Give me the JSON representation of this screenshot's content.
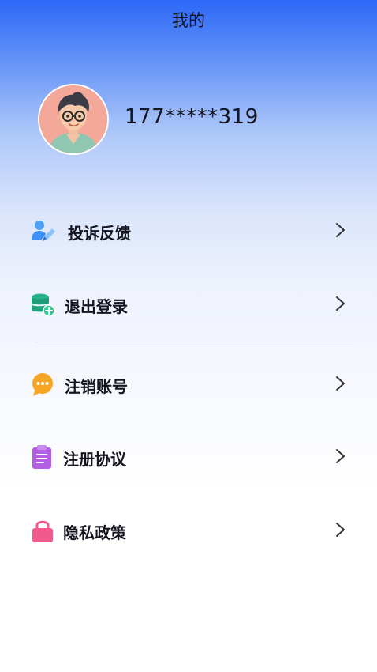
{
  "header": {
    "title": "我的"
  },
  "profile": {
    "phone": "177*****319"
  },
  "menu": [
    {
      "label": "投诉反馈",
      "icon": "user-edit-icon"
    },
    {
      "label": "退出登录",
      "icon": "database-add-icon"
    },
    {
      "label": "注销账号",
      "icon": "chat-bubble-icon"
    },
    {
      "label": "注册协议",
      "icon": "clipboard-icon"
    },
    {
      "label": "隐私政策",
      "icon": "lock-icon"
    }
  ],
  "colors": {
    "header_blue": "#2d68f7",
    "icon_blue": "#3d8ff5",
    "icon_green": "#1fa37a",
    "icon_orange": "#f5a623",
    "icon_purple": "#b05ee0",
    "icon_pink": "#f25a8e"
  }
}
